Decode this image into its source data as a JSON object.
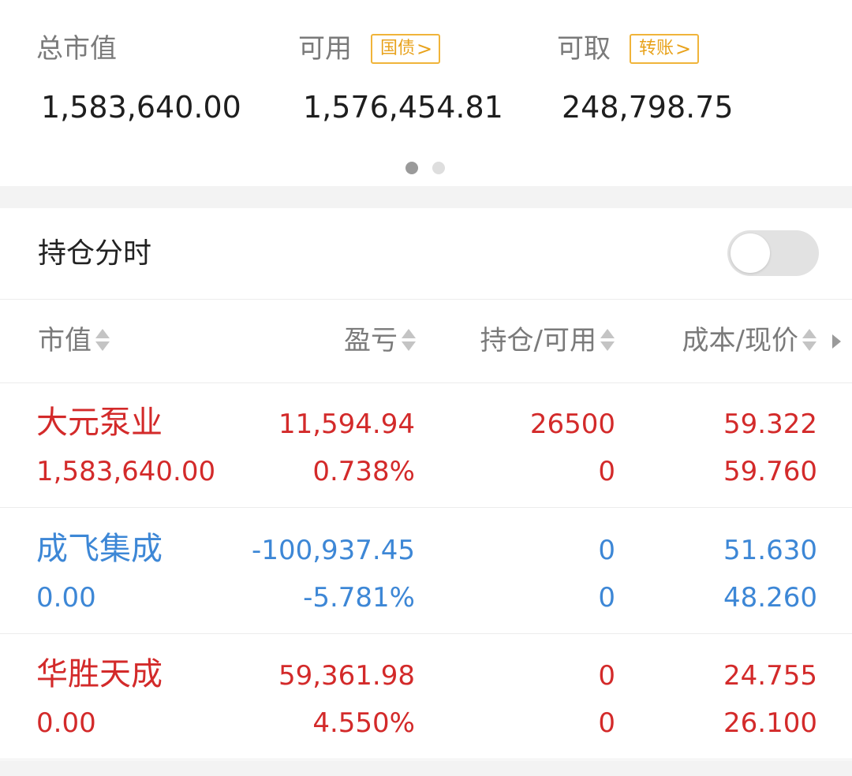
{
  "summary": {
    "total": {
      "label": "总市值",
      "value": "1,583,640.00"
    },
    "available": {
      "label": "可用",
      "tag": "国债",
      "value": "1,576,454.81"
    },
    "withdrawable": {
      "label": "可取",
      "tag": "转账",
      "value": "248,798.75"
    },
    "pager": {
      "count": 2,
      "active": 1
    }
  },
  "toggle": {
    "label": "持仓分时",
    "on": false
  },
  "table": {
    "headers": [
      "市值",
      "盈亏",
      "持仓/可用",
      "成本/现价"
    ],
    "rows": [
      {
        "name": "大元泵业",
        "market_value": "1,583,640.00",
        "pnl": "11,594.94",
        "pnl_pct": "0.738%",
        "position": "26500",
        "available": "0",
        "cost": "59.322",
        "price": "59.760",
        "color": "#d32a2a"
      },
      {
        "name": "成飞集成",
        "market_value": "0.00",
        "pnl": "-100,937.45",
        "pnl_pct": "-5.781%",
        "position": "0",
        "available": "0",
        "cost": "51.630",
        "price": "48.260",
        "color": "#3d87d6"
      },
      {
        "name": "华胜天成",
        "market_value": "0.00",
        "pnl": "59,361.98",
        "pnl_pct": "4.550%",
        "position": "0",
        "available": "0",
        "cost": "24.755",
        "price": "26.100",
        "color": "#d32a2a"
      }
    ]
  },
  "colors": {
    "gain": "#d32a2a",
    "loss": "#3d87d6",
    "tag": "#e8a21b"
  }
}
